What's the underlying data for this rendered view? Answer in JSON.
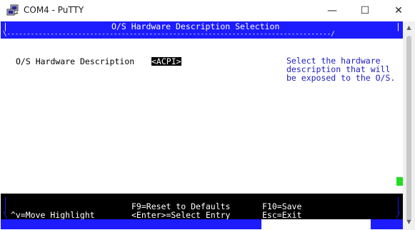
{
  "window": {
    "title": "COM4 - PuTTY",
    "minimize_glyph": "—",
    "maximize_glyph": "☐",
    "close_glyph": "✕",
    "icon": "putty-icon"
  },
  "terminal": {
    "header_title": "O/S Hardware Description Selection",
    "header_left_edge": "|",
    "header_right_edge": "|",
    "header_dashes": "\\----------------------------------------------------------------------------------/",
    "setting_label": "O/S Hardware Description",
    "setting_value": "<ACPI>",
    "help_lines": [
      "Select the hardware",
      "description that will",
      "be exposed to the O/S."
    ],
    "footer": {
      "line1_mid": "F9=Reset to Defaults",
      "line1_right": "F10=Save",
      "line2_left": "^v=Move Highlight",
      "line2_mid": "<Enter>=Select Entry",
      "line2_right": "Esc=Exit",
      "left_edge_1": "|",
      "left_edge_2": "\\",
      "right_edge_1": "|",
      "right_edge_2": "/"
    },
    "colors": {
      "header_bg": "#1c1cff",
      "help_text": "#1c1cbf",
      "cursor": "#22dd22",
      "footer_bg": "#000000"
    }
  },
  "scrollbar": {
    "up_glyph": "▲",
    "down_glyph": "▼"
  }
}
